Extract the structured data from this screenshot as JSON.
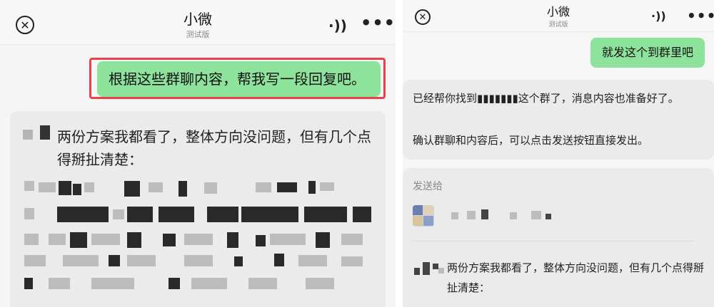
{
  "left_screen": {
    "header": {
      "title": "小微",
      "subtitle": "测试版",
      "close_icon": "close-circle-icon",
      "audio_icon": "sound-icon",
      "more_icon": "more-icon"
    },
    "user_message": "根据这些群聊内容，帮我写一段回复吧。",
    "card_text": "两份方案我都看了，整体方向没问题，但有几个点得掰扯清楚："
  },
  "right_screen": {
    "header": {
      "title": "小微",
      "subtitle": "测试版"
    },
    "user_message": "就发这个到群里吧",
    "assistant_line1": "已经帮你找到▮▮▮▮▮▮▮这个群了，消息内容也准备好了。",
    "assistant_line2": "确认群聊和内容后，可以点击发送按钮直接发出。",
    "send_to_label": "发送给",
    "preview_text": "两份方案我都看了，整体方向没问题，但有几个点得掰扯清楚："
  },
  "colors": {
    "user_bubble": "#8de29c",
    "highlight": "#e8434a",
    "card_bg": "#ebebeb"
  }
}
